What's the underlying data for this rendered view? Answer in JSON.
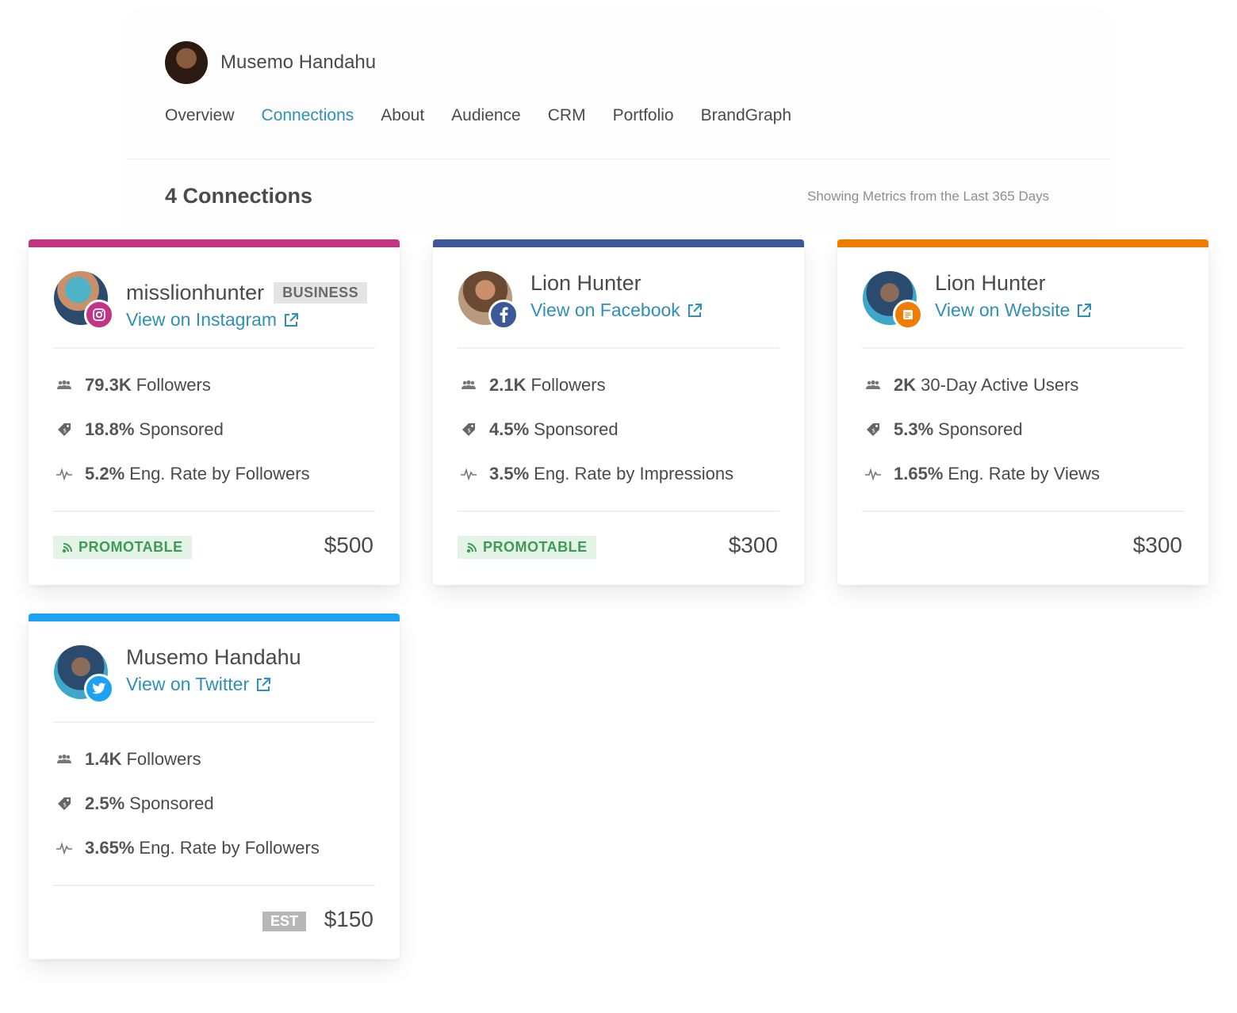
{
  "profile": {
    "name": "Musemo Handahu"
  },
  "tabs": [
    {
      "label": "Overview",
      "active": false
    },
    {
      "label": "Connections",
      "active": true
    },
    {
      "label": "About",
      "active": false
    },
    {
      "label": "Audience",
      "active": false
    },
    {
      "label": "CRM",
      "active": false
    },
    {
      "label": "Portfolio",
      "active": false
    },
    {
      "label": "BrandGraph",
      "active": false
    }
  ],
  "connections_header": {
    "count_label": "4 Connections",
    "metrics_note": "Showing Metrics from the Last 365 Days"
  },
  "colors": {
    "instagram": "#c13584",
    "facebook": "#3b5998",
    "website": "#f07c00",
    "twitter": "#1da1f2",
    "link": "#2e8fb8",
    "promotable": "#3f9a55"
  },
  "cards": [
    {
      "network": "instagram",
      "title": "misslionhunter",
      "tag": "BUSINESS",
      "link": "View on Instagram",
      "stats": [
        {
          "icon": "users-icon",
          "value": "79.3K",
          "label": "Followers"
        },
        {
          "icon": "price-tag-icon",
          "value": "18.8%",
          "label": "Sponsored"
        },
        {
          "icon": "pulse-icon",
          "value": "5.2%",
          "label": "Eng. Rate by Followers"
        }
      ],
      "promo": "PROMOTABLE",
      "est": "",
      "price": "$500"
    },
    {
      "network": "facebook",
      "title": "Lion Hunter",
      "tag": "",
      "link": "View on Facebook",
      "stats": [
        {
          "icon": "users-icon",
          "value": "2.1K",
          "label": "Followers"
        },
        {
          "icon": "price-tag-icon",
          "value": "4.5%",
          "label": "Sponsored"
        },
        {
          "icon": "pulse-icon",
          "value": "3.5%",
          "label": "Eng. Rate by Impressions"
        }
      ],
      "promo": "PROMOTABLE",
      "est": "",
      "price": "$300"
    },
    {
      "network": "website",
      "title": "Lion Hunter",
      "tag": "",
      "link": "View on Website",
      "stats": [
        {
          "icon": "users-icon",
          "value": "2K",
          "label": "30-Day Active Users"
        },
        {
          "icon": "price-tag-icon",
          "value": "5.3%",
          "label": "Sponsored"
        },
        {
          "icon": "pulse-icon",
          "value": "1.65%",
          "label": "Eng. Rate by Views"
        }
      ],
      "promo": "",
      "est": "",
      "price": "$300"
    },
    {
      "network": "twitter",
      "title": "Musemo Handahu",
      "tag": "",
      "link": "View on Twitter",
      "stats": [
        {
          "icon": "users-icon",
          "value": "1.4K",
          "label": "Followers"
        },
        {
          "icon": "price-tag-icon",
          "value": "2.5%",
          "label": "Sponsored"
        },
        {
          "icon": "pulse-icon",
          "value": "3.65%",
          "label": "Eng. Rate by Followers"
        }
      ],
      "promo": "",
      "est": "EST",
      "price": "$150"
    }
  ]
}
